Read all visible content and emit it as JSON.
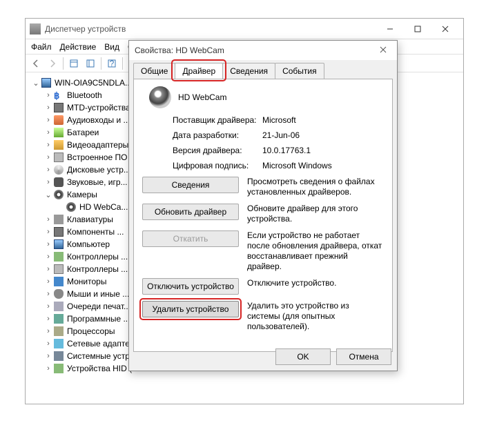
{
  "mainWindow": {
    "title": "Диспетчер устройств",
    "menu": [
      "Файл",
      "Действие",
      "Вид",
      "Справка"
    ]
  },
  "tree": {
    "root": "WIN-OIA9C5NDLA...",
    "items": [
      {
        "icon": "bt",
        "label": "Bluetooth",
        "exp": ">"
      },
      {
        "icon": "chip",
        "label": "MTD-устройства",
        "exp": ">"
      },
      {
        "icon": "audio",
        "label": "Аудиовходы и ...",
        "exp": ">"
      },
      {
        "icon": "bat",
        "label": "Батареи",
        "exp": ">"
      },
      {
        "icon": "vid",
        "label": "Видеоадаптеры",
        "exp": ">"
      },
      {
        "icon": "hdd",
        "label": "Встроенное ПО",
        "exp": ">"
      },
      {
        "icon": "disk",
        "label": "Дисковые устр...",
        "exp": ">"
      },
      {
        "icon": "joy",
        "label": "Звуковые, игр...",
        "exp": ">"
      },
      {
        "icon": "cam",
        "label": "Камеры",
        "exp": "v",
        "children": [
          {
            "icon": "cam",
            "label": "HD WebCa..."
          }
        ]
      },
      {
        "icon": "kb",
        "label": "Клавиатуры",
        "exp": ">"
      },
      {
        "icon": "chip",
        "label": "Компоненты ...",
        "exp": ">"
      },
      {
        "icon": "pc",
        "label": "Компьютер",
        "exp": ">"
      },
      {
        "icon": "usb",
        "label": "Контроллеры ...",
        "exp": ">"
      },
      {
        "icon": "hdd",
        "label": "Контроллеры ...",
        "exp": ">"
      },
      {
        "icon": "mon",
        "label": "Мониторы",
        "exp": ">"
      },
      {
        "icon": "mouse",
        "label": "Мыши и иные ...",
        "exp": ">"
      },
      {
        "icon": "prn",
        "label": "Очереди печат...",
        "exp": ">"
      },
      {
        "icon": "sw",
        "label": "Программные ...",
        "exp": ">"
      },
      {
        "icon": "cpu",
        "label": "Процессоры",
        "exp": ">"
      },
      {
        "icon": "net",
        "label": "Сетевые адаптеры",
        "exp": ">"
      },
      {
        "icon": "sys",
        "label": "Системные устройства",
        "exp": ">"
      },
      {
        "icon": "usb",
        "label": "Устройства HID (Human Int...",
        "exp": ">"
      }
    ]
  },
  "props": {
    "title": "Свойства: HD WebCam",
    "tabs": [
      "Общие",
      "Драйвер",
      "Сведения",
      "События"
    ],
    "activeTab": 1,
    "deviceName": "HD WebCam",
    "info": [
      {
        "label": "Поставщик драйвера:",
        "value": "Microsoft"
      },
      {
        "label": "Дата разработки:",
        "value": "21-Jun-06"
      },
      {
        "label": "Версия драйвера:",
        "value": "10.0.17763.1"
      },
      {
        "label": "Цифровая подпись:",
        "value": "Microsoft Windows"
      }
    ],
    "actions": [
      {
        "button": "Сведения",
        "desc": "Просмотреть сведения о файлах установленных драйверов."
      },
      {
        "button": "Обновить драйвер",
        "desc": "Обновите драйвер для этого устройства."
      },
      {
        "button": "Откатить",
        "desc": "Если устройство не работает после обновления драйвера, откат восстанавливает прежний драйвер.",
        "disabled": true
      },
      {
        "button": "Отключить устройство",
        "desc": "Отключите устройство."
      },
      {
        "button": "Удалить устройство",
        "desc": "Удалить это устройство из системы (для опытных пользователей).",
        "highlight": true
      }
    ],
    "ok": "OK",
    "cancel": "Отмена"
  }
}
